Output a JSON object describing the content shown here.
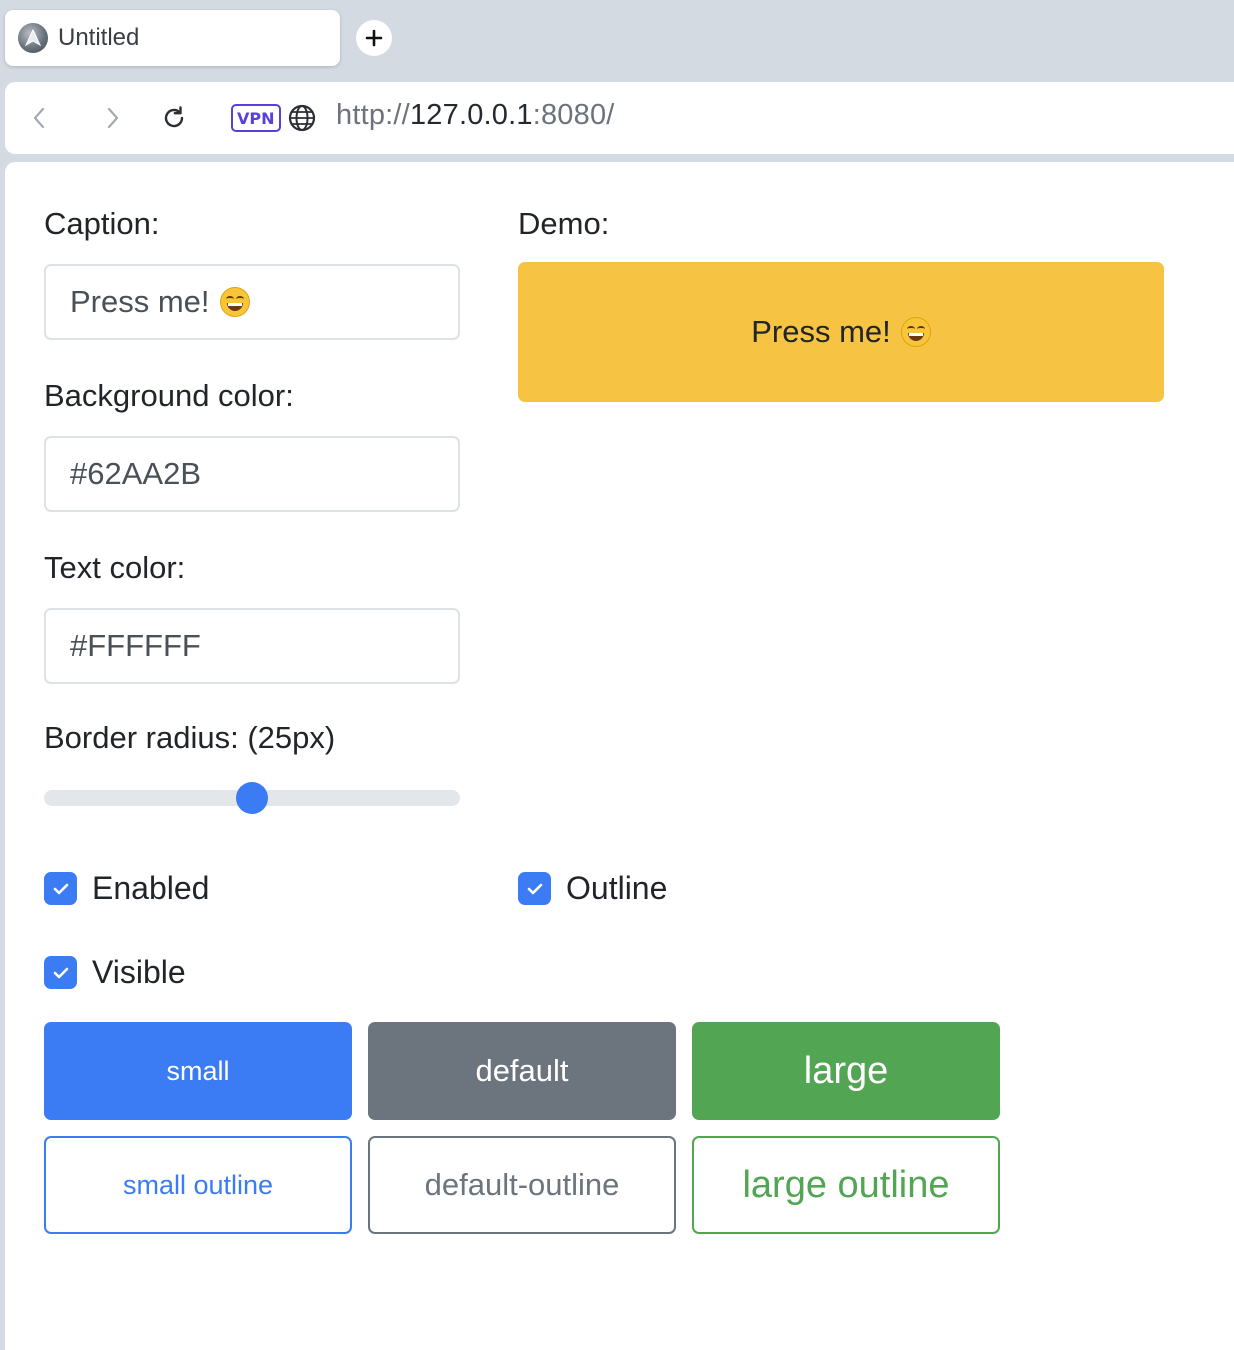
{
  "browser": {
    "tab_title": "Untitled",
    "vpn_label": "VPN",
    "url_scheme": "http://",
    "url_host": "127.0.0.1",
    "url_port": ":8080/"
  },
  "form": {
    "caption_label": "Caption:",
    "caption_value": "Press me!",
    "bg_label": "Background color:",
    "bg_value": "#62AA2B",
    "text_label": "Text color:",
    "text_value": "#FFFFFF",
    "radius_label": "Border radius: (25px)",
    "radius_fraction": 0.5,
    "enabled_label": "Enabled",
    "enabled_checked": true,
    "visible_label": "Visible",
    "visible_checked": true,
    "outline_label": "Outline",
    "outline_checked": true
  },
  "demo": {
    "label": "Demo:",
    "button_label": "Press me!",
    "button_color": "#F6C343"
  },
  "buttons": {
    "small": "small",
    "default": "default",
    "large": "large",
    "small_outline": "small outline",
    "default_outline": "default-outline",
    "large_outline": "large outline"
  },
  "colors": {
    "primary": "#3B7CF4",
    "secondary": "#6C757D",
    "success": "#52A653"
  }
}
